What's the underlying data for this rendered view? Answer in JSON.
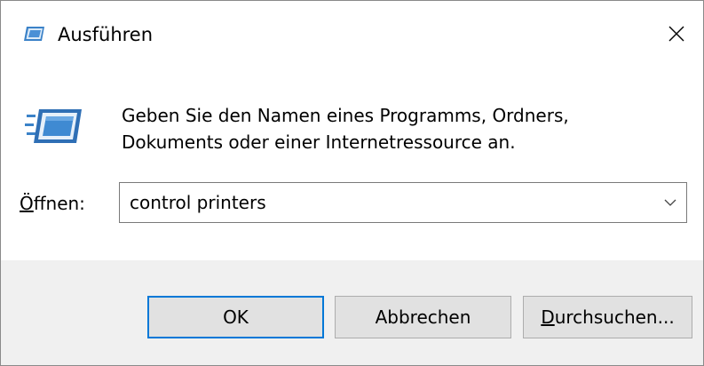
{
  "window": {
    "title": "Ausführen",
    "icon": "run-icon",
    "close_icon": "close-icon"
  },
  "main": {
    "icon": "run-icon",
    "description_line1": "Geben Sie den Namen eines Programms, Ordners,",
    "description_line2": "Dokuments oder einer Internetressource an."
  },
  "open_field": {
    "label_accesskey": "Ö",
    "label_rest": "ffnen:",
    "value": "control printers",
    "dropdown_icon": "chevron-down-icon"
  },
  "buttons": {
    "ok_label": "OK",
    "cancel_label": "Abbrechen",
    "browse_accesskey": "D",
    "browse_rest": "urchsuchen..."
  },
  "colors": {
    "footer_bg": "#f0f0f0",
    "button_bg": "#e1e1e1",
    "default_button_border": "#0078d7",
    "icon_blue": "#2f6fb5"
  }
}
